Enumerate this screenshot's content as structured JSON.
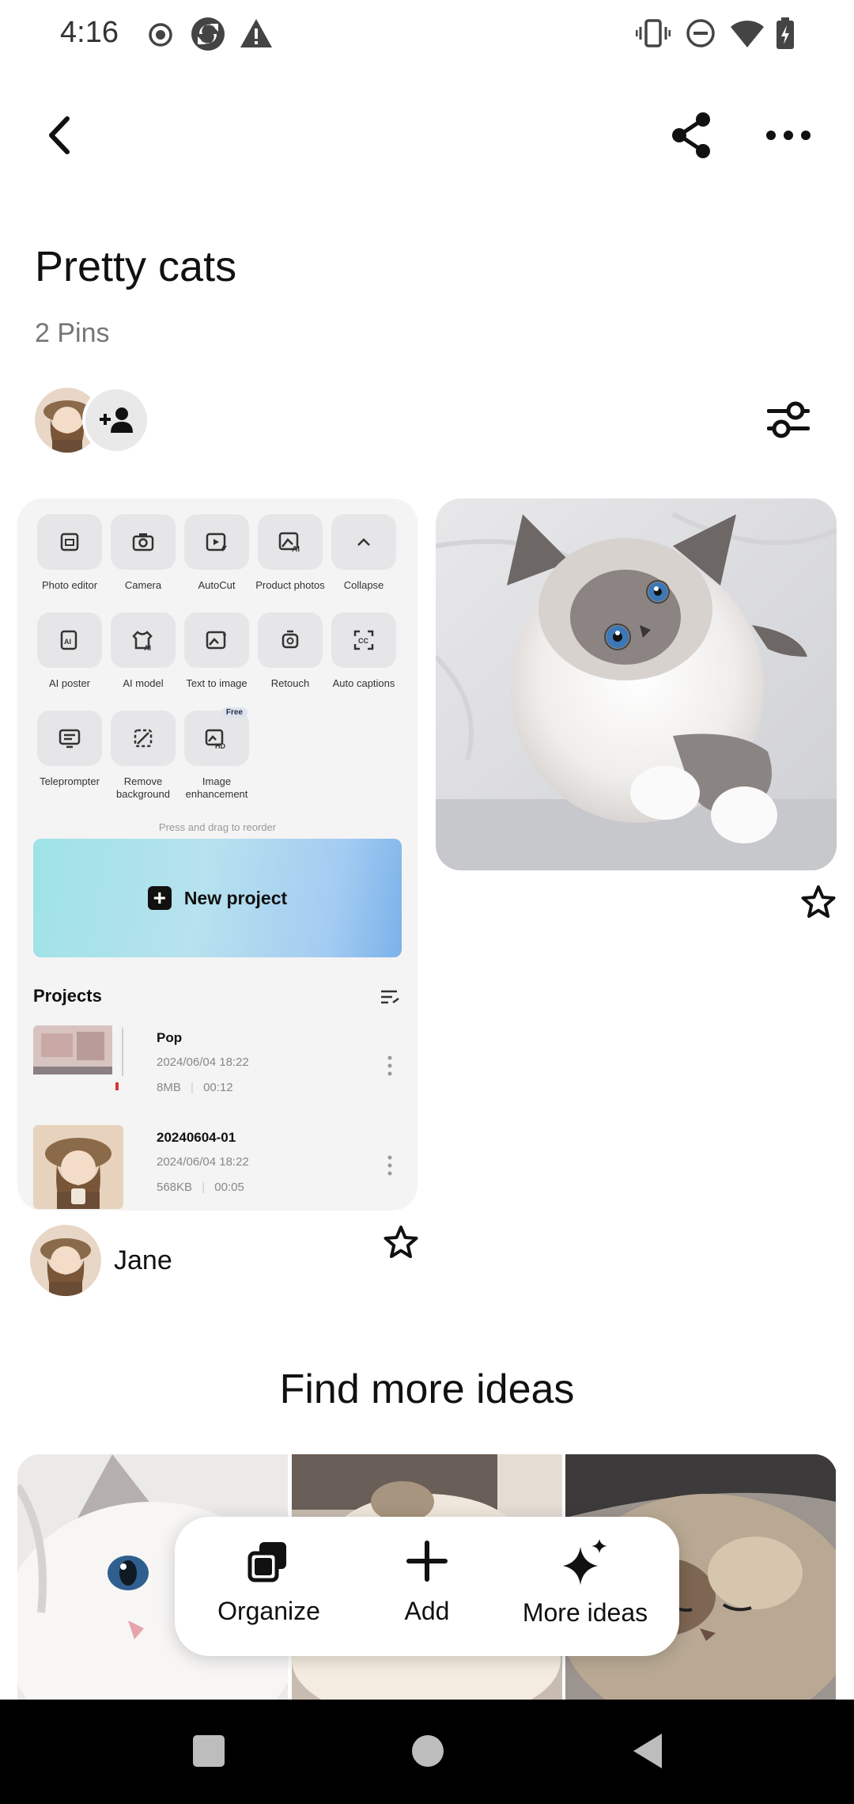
{
  "status_bar": {
    "time": "4:16",
    "left_icons": [
      "record-icon",
      "sync-icon",
      "warning-icon"
    ],
    "right_icons": [
      "vibrate-icon",
      "dnd-icon",
      "wifi-icon",
      "battery-charging-icon"
    ]
  },
  "top_bar": {
    "back_icon": "chevron-left-icon",
    "share_icon": "share-icon",
    "more_icon": "more-horizontal-icon"
  },
  "board": {
    "title": "Pretty cats",
    "pin_count": "2 Pins",
    "filter_icon": "sliders-icon"
  },
  "pin_screenshot": {
    "tools": [
      {
        "label": "Photo editor",
        "icon": "photo-editor-icon"
      },
      {
        "label": "Camera",
        "icon": "camera-icon"
      },
      {
        "label": "AutoCut",
        "icon": "autocut-icon"
      },
      {
        "label": "Product photos",
        "icon": "product-photos-icon"
      },
      {
        "label": "Collapse",
        "icon": "chevron-up-icon"
      },
      {
        "label": "AI poster",
        "icon": "ai-poster-icon"
      },
      {
        "label": "AI model",
        "icon": "ai-model-icon"
      },
      {
        "label": "Text to image",
        "icon": "text-to-image-icon"
      },
      {
        "label": "Retouch",
        "icon": "retouch-icon"
      },
      {
        "label": "Auto captions",
        "icon": "auto-captions-icon"
      },
      {
        "label": "Teleprompter",
        "icon": "teleprompter-icon"
      },
      {
        "label": "Remove background",
        "icon": "remove-background-icon"
      },
      {
        "label": "Image enhancement",
        "icon": "image-enhancement-icon",
        "badge": "Free"
      }
    ],
    "hint": "Press and drag to reorder",
    "new_project_label": "New project",
    "projects_title": "Projects",
    "projects": [
      {
        "name": "Pop",
        "date": "2024/06/04 18:22",
        "size": "8MB",
        "duration": "00:12"
      },
      {
        "name": "20240604-01",
        "date": "2024/06/04 18:22",
        "size": "568KB",
        "duration": "00:05"
      }
    ]
  },
  "pinner": {
    "name": "Jane"
  },
  "find_more": {
    "title": "Find more ideas"
  },
  "actions": [
    {
      "label": "Organize",
      "icon": "organize-icon"
    },
    {
      "label": "Add",
      "icon": "plus-icon"
    },
    {
      "label": "More ideas",
      "icon": "sparkle-icon"
    }
  ],
  "nav_bar": {
    "buttons": [
      "recents-square-icon",
      "home-circle-icon",
      "back-triangle-icon"
    ]
  }
}
